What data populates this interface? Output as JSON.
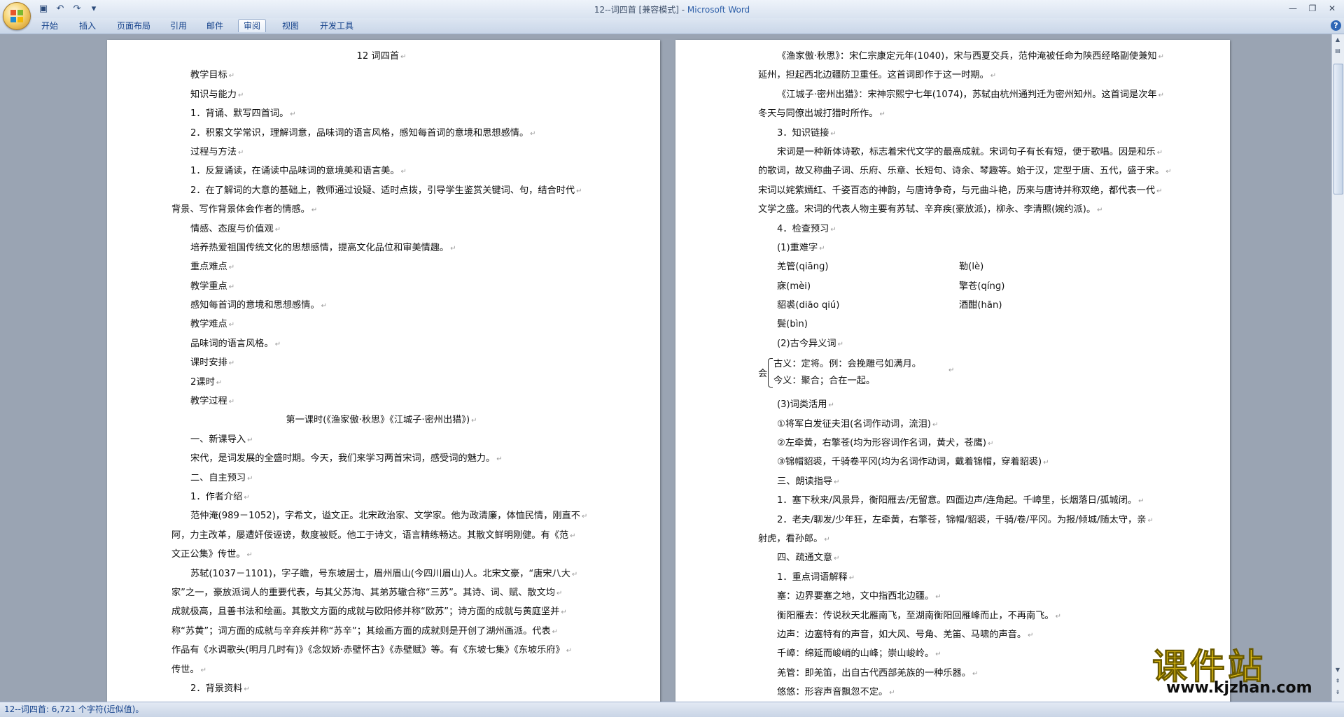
{
  "window": {
    "title": "12--词四首 [兼容模式] - ",
    "app_name": "Microsoft Word"
  },
  "quick_access": {
    "save_icon": "save-icon",
    "undo_icon": "undo-icon",
    "redo_icon": "redo-icon",
    "more_icon": "customize-icon"
  },
  "ribbon": {
    "tabs": [
      {
        "label": "开始"
      },
      {
        "label": "插入"
      },
      {
        "label": "页面布局"
      },
      {
        "label": "引用"
      },
      {
        "label": "邮件"
      },
      {
        "label": "审阅"
      },
      {
        "label": "视图"
      },
      {
        "label": "开发工具"
      }
    ],
    "active_tab": "审阅"
  },
  "page1": {
    "lines": [
      {
        "t": "12  词四首",
        "s": "center"
      },
      {
        "t": "教学目标",
        "s": "ind"
      },
      {
        "t": "知识与能力",
        "s": "ind"
      },
      {
        "t": "1．背诵、默写四首词。",
        "s": "ind"
      },
      {
        "t": "2．积累文学常识，理解词意，品味词的语言风格，感知每首词的意境和思想感情。",
        "s": "ind"
      },
      {
        "t": "过程与方法",
        "s": "ind"
      },
      {
        "t": "1．反复诵读，在诵读中品味词的意境美和语言美。",
        "s": "ind"
      },
      {
        "t": "2．在了解词的大意的基础上，教师通过设疑、适时点拨，引导学生鉴赏关键词、句，结合时代",
        "s": "ind"
      },
      {
        "t": "背景、写作背景体会作者的情感。",
        "s": ""
      },
      {
        "t": "情感、态度与价值观",
        "s": "ind"
      },
      {
        "t": "培养热爱祖国传统文化的思想感情，提高文化品位和审美情趣。",
        "s": "ind"
      },
      {
        "t": "重点难点",
        "s": "ind"
      },
      {
        "t": "教学重点",
        "s": "ind"
      },
      {
        "t": "感知每首词的意境和思想感情。",
        "s": "ind"
      },
      {
        "t": "教学难点",
        "s": "ind"
      },
      {
        "t": "品味词的语言风格。",
        "s": "ind"
      },
      {
        "t": "课时安排",
        "s": "ind"
      },
      {
        "t": "2课时",
        "s": "ind"
      },
      {
        "t": "教学过程",
        "s": "ind"
      },
      {
        "t": "第一课时(《渔家傲·秋思》《江城子·密州出猎》)",
        "s": "center"
      },
      {
        "t": "一、新课导入",
        "s": "ind"
      },
      {
        "t": "宋代，是词发展的全盛时期。今天，我们来学习两首宋词，感受词的魅力。",
        "s": "ind"
      },
      {
        "t": "二、自主预习",
        "s": "ind"
      },
      {
        "t": "1．作者介绍",
        "s": "ind"
      },
      {
        "t": "范仲淹(989－1052)，字希文，谥文正。北宋政治家、文学家。他为政清廉，体恤民情，刚直不",
        "s": "ind"
      },
      {
        "t": "阿，力主改革，屡遭奸佞诬谤，数度被贬。他工于诗文，语言精练畅达。其散文鲜明刚健。有《范",
        "s": ""
      },
      {
        "t": "文正公集》传世。",
        "s": ""
      },
      {
        "t": "苏轼(1037－1101)，字子瞻，号东坡居士，眉州眉山(今四川眉山)人。北宋文豪，“唐宋八大",
        "s": "ind"
      },
      {
        "t": "家”之一，豪放派词人的重要代表，与其父苏洵、其弟苏辙合称“三苏”。其诗、词、赋、散文均",
        "s": ""
      },
      {
        "t": "成就极高，且善书法和绘画。其散文方面的成就与欧阳修并称“欧苏”；诗方面的成就与黄庭坚并",
        "s": ""
      },
      {
        "t": "称“苏黄”；词方面的成就与辛弃疾并称“苏辛”；其绘画方面的成就则是开创了湖州画派。代表",
        "s": ""
      },
      {
        "t": "作品有《水调歌头(明月几时有)》《念奴娇·赤壁怀古》《赤壁赋》等。有《东坡七集》《东坡乐府》",
        "s": ""
      },
      {
        "t": "传世。",
        "s": ""
      },
      {
        "t": "2．背景资料",
        "s": "ind"
      }
    ]
  },
  "page2": {
    "lines_a": [
      {
        "t": "《渔家傲·秋思》：宋仁宗康定元年(1040)，宋与西夏交兵，范仲淹被任命为陕西经略副使兼知",
        "s": "ind"
      },
      {
        "t": "延州，担起西北边疆防卫重任。这首词即作于这一时期。",
        "s": ""
      },
      {
        "t": "《江城子·密州出猎》：宋神宗熙宁七年(1074)，苏轼由杭州通判迁为密州知州。这首词是次年",
        "s": "ind"
      },
      {
        "t": "冬天与同僚出城打猎时所作。",
        "s": ""
      },
      {
        "t": "3．知识链接",
        "s": "ind"
      },
      {
        "t": "宋词是一种新体诗歌，标志着宋代文学的最高成就。宋词句子有长有短，便于歌唱。因是和乐",
        "s": "ind"
      },
      {
        "t": "的歌词，故又称曲子词、乐府、乐章、长短句、诗余、琴趣等。始于汉，定型于唐、五代，盛于宋。",
        "s": ""
      },
      {
        "t": "宋词以姹紫嫣红、千姿百态的神韵，与唐诗争奇，与元曲斗艳，历来与唐诗并称双绝，都代表一代",
        "s": ""
      },
      {
        "t": "文学之盛。宋词的代表人物主要有苏轼、辛弃疾(豪放派)，柳永、李清照(婉约派)。",
        "s": ""
      },
      {
        "t": "4．检查预习",
        "s": "ind"
      },
      {
        "t": "(1)重难字",
        "s": "ind"
      }
    ],
    "pairs": [
      {
        "a": "羌管(qiānɡ)",
        "b": "勒(lè)"
      },
      {
        "a": "寐(mèi)",
        "b": "擎苍(qínɡ)"
      },
      {
        "a": "貂裘(diāo qiú)",
        "b": "酒酣(hān)"
      },
      {
        "a": "鬓(bìn)",
        "b": ""
      }
    ],
    "gujin_title": "(2)古今异义词",
    "gujin_head": "会",
    "gujin_old": "古义：定将。例：会挽雕弓如满月。",
    "gujin_new": "今义：聚合；合在一起。",
    "lines_b": [
      {
        "t": "(3)词类活用",
        "s": "ind"
      },
      {
        "t": "①将军白发征夫泪(名词作动词，流泪)",
        "s": "ind"
      },
      {
        "t": "②左牵黄，右擎苍(均为形容词作名词，黄犬，苍鹰)",
        "s": "ind"
      },
      {
        "t": "③锦帽貂裘，千骑卷平冈(均为名词作动词，戴着锦帽，穿着貂裘)",
        "s": "ind"
      },
      {
        "t": "三、朗读指导",
        "s": "ind"
      },
      {
        "t": "1．塞下秋来/风景异，衡阳雁去/无留意。四面边声/连角起。千嶂里，长烟落日/孤城闭。",
        "s": "ind"
      },
      {
        "t": "2．老夫/聊发/少年狂，左牵黄，右擎苍，锦帽/貂裘，千骑/卷/平冈。为报/倾城/随太守，亲",
        "s": "ind"
      },
      {
        "t": "射虎，看孙郎。",
        "s": ""
      },
      {
        "t": "四、疏通文意",
        "s": "ind"
      },
      {
        "t": "1．重点词语解释",
        "s": "ind"
      },
      {
        "t": "塞：边界要塞之地，文中指西北边疆。",
        "s": "ind"
      },
      {
        "t": "衡阳雁去：传说秋天北雁南飞，至湖南衡阳回雁峰而止，不再南飞。",
        "s": "ind"
      },
      {
        "t": "边声：边塞特有的声音，如大风、号角、羌笛、马啸的声音。",
        "s": "ind"
      },
      {
        "t": "千嶂：绵延而峻峭的山峰；崇山峻岭。",
        "s": "ind"
      },
      {
        "t": "羌管：即羌笛，出自古代西部羌族的一种乐器。",
        "s": "ind"
      },
      {
        "t": "悠悠：形容声音飘忽不定。",
        "s": "ind"
      }
    ]
  },
  "statusbar": {
    "text": "12--词四首: 6,721 个字符(近似值)。"
  },
  "watermark": {
    "title": "课件站",
    "url": "www.kjzhan.com"
  },
  "colors": {
    "accent": "#15428b",
    "watermark": "#f5ce16",
    "app_name": "#2e5fa8"
  }
}
